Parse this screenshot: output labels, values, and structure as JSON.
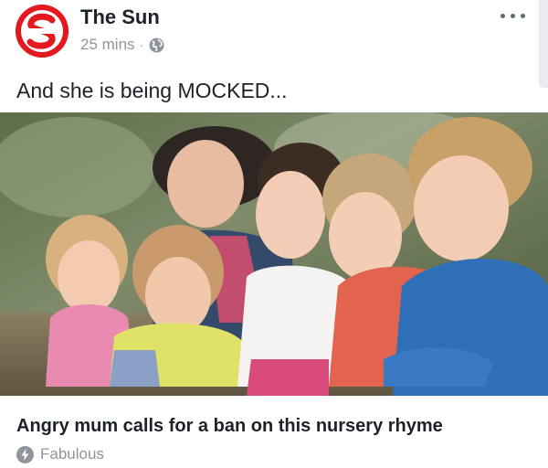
{
  "post": {
    "page_name": "The Sun",
    "time": "25 mins",
    "separator": "·",
    "privacy_icon": "globe-icon",
    "more_icon": "more-options-icon",
    "caption": "And she is being MOCKED...",
    "link": {
      "headline": "Angry mum calls for a ban on this nursery rhyme",
      "source": "Fabulous",
      "source_icon": "lightning-bolt-icon",
      "image_description_icon": "link-preview-image"
    }
  },
  "colors": {
    "brand_red": "#e3191f",
    "text_primary": "#1d2129",
    "text_secondary": "#90949c"
  }
}
